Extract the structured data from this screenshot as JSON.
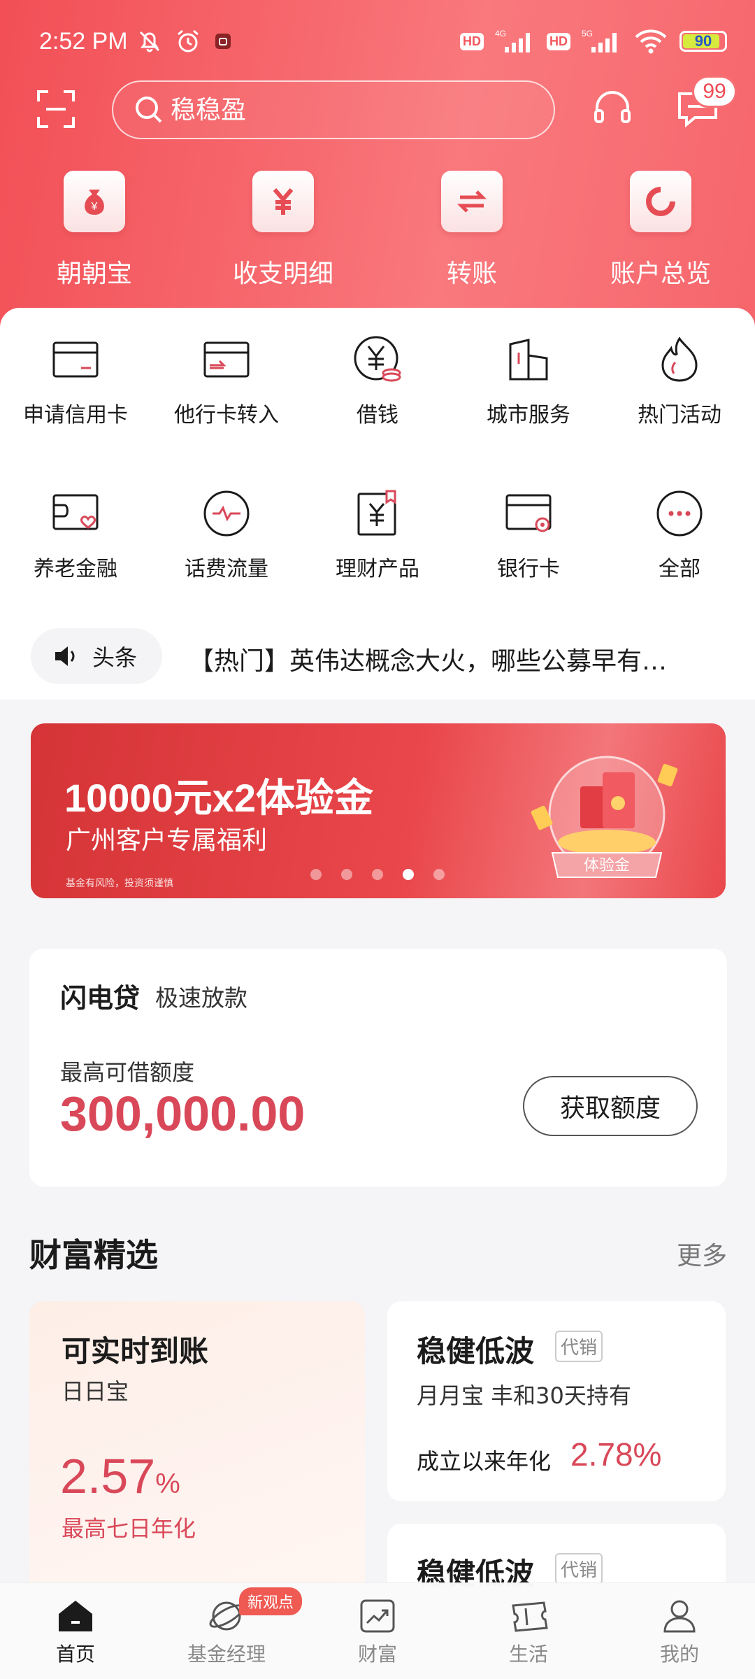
{
  "status_bar": {
    "time": "2:52 PM",
    "network_1": "4G",
    "network_2": "5G",
    "hd": "HD",
    "battery": "90"
  },
  "header": {
    "search_placeholder": "稳稳盈",
    "message_count": "99",
    "quick_actions": [
      {
        "label": "朝朝宝",
        "icon": "money-bag-icon"
      },
      {
        "label": "收支明细",
        "icon": "yuan-icon"
      },
      {
        "label": "转账",
        "icon": "transfer-icon"
      },
      {
        "label": "账户总览",
        "icon": "ring-chart-icon"
      }
    ]
  },
  "services": {
    "row1": [
      {
        "label": "申请信用卡",
        "icon": "credit-card-icon"
      },
      {
        "label": "他行卡转入",
        "icon": "card-transfer-icon"
      },
      {
        "label": "借钱",
        "icon": "borrow-icon"
      },
      {
        "label": "城市服务",
        "icon": "building-icon"
      },
      {
        "label": "热门活动",
        "icon": "flame-icon"
      }
    ],
    "row2": [
      {
        "label": "养老金融",
        "icon": "pension-card-icon"
      },
      {
        "label": "话费流量",
        "icon": "pulse-icon"
      },
      {
        "label": "理财产品",
        "icon": "wealth-doc-icon"
      },
      {
        "label": "银行卡",
        "icon": "bank-card-icon"
      },
      {
        "label": "全部",
        "icon": "more-dots-icon"
      }
    ]
  },
  "headline": {
    "tag": "头条",
    "text": "【热门】英伟达概念大火，哪些公募早有…"
  },
  "banner": {
    "title": "10000元x2体验金",
    "subtitle": "广州客户专属福利",
    "note": "基金有风险，投资须谨慎",
    "art_label": "体验金",
    "dot_count": 5,
    "active_dot": 3
  },
  "loan": {
    "title": "闪电贷",
    "subtitle": "极速放款",
    "label": "最高可借额度",
    "amount": "300,000.00",
    "button": "获取额度"
  },
  "wealth": {
    "title": "财富精选",
    "more": "更多",
    "left": {
      "title": "可实时到账",
      "subtitle": "日日宝",
      "rate": "2.57",
      "unit": "%",
      "rate_label": "最高七日年化"
    },
    "right": [
      {
        "title": "稳健低波",
        "tag": "代销",
        "subtitle": "月月宝 丰和30天持有",
        "rate_label": "成立以来年化",
        "rate": "2.78%"
      },
      {
        "title": "稳健低波",
        "tag": "代销"
      }
    ]
  },
  "bottom_nav": [
    {
      "label": "首页",
      "icon": "home-icon",
      "active": true
    },
    {
      "label": "基金经理",
      "icon": "planet-icon",
      "badge": "新观点"
    },
    {
      "label": "财富",
      "icon": "chart-up-icon"
    },
    {
      "label": "生活",
      "icon": "ticket-icon"
    },
    {
      "label": "我的",
      "icon": "user-icon"
    }
  ],
  "colors": {
    "brand_red": "#f24f56",
    "amount_red": "#d94859"
  }
}
